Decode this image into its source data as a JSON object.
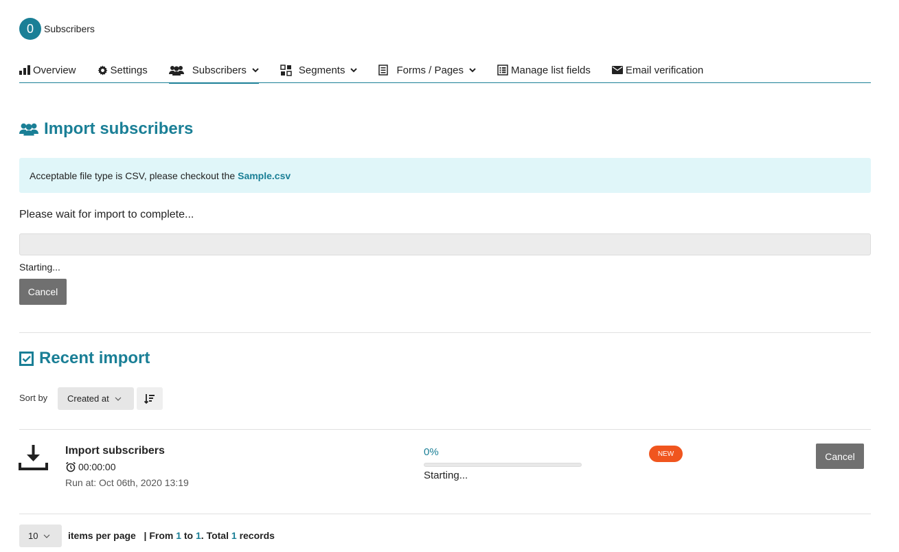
{
  "header": {
    "count": "0",
    "list_name": "Subscribers"
  },
  "tabs": [
    {
      "label": "Overview",
      "icon": "bar-chart-icon"
    },
    {
      "label": "Settings",
      "icon": "gear-icon"
    },
    {
      "label": "Subscribers",
      "icon": "users-icon",
      "active": true,
      "dropdown": true
    },
    {
      "label": "Segments",
      "icon": "segments-icon",
      "dropdown": true
    },
    {
      "label": "Forms / Pages",
      "icon": "form-icon",
      "dropdown": true
    },
    {
      "label": "Manage list fields",
      "icon": "list-fields-icon"
    },
    {
      "label": "Email verification",
      "icon": "envelope-icon"
    }
  ],
  "import": {
    "title": "Import subscribers",
    "alert_text": "Acceptable file type is CSV, please checkout the",
    "alert_link": "Sample.csv",
    "wait_text": "Please wait for import to complete...",
    "progress_fraction": 0,
    "status": "Starting...",
    "cancel_label": "Cancel"
  },
  "recent": {
    "title": "Recent import",
    "sort_label": "Sort by",
    "sort_value": "Created at",
    "rows": [
      {
        "title": "Import subscribers",
        "duration": "00:00:00",
        "run_at": "Run at: Oct 06th, 2020 13:19",
        "percent": "0%",
        "progress_fraction": 0,
        "status": "Starting...",
        "badge": "NEW",
        "cancel_label": "Cancel"
      }
    ]
  },
  "pagination": {
    "per_page": "10",
    "per_page_label": "items per page",
    "sep": "|",
    "from_label": "From",
    "from": "1",
    "to_label": "to",
    "to": "1",
    "total_label": ". Total",
    "total": "1",
    "records_label": "records"
  },
  "colors": {
    "accent": "#1a7f96",
    "badge_new": "#f0551e",
    "alert_bg": "#e0f6f9",
    "button_gray": "#707070"
  }
}
